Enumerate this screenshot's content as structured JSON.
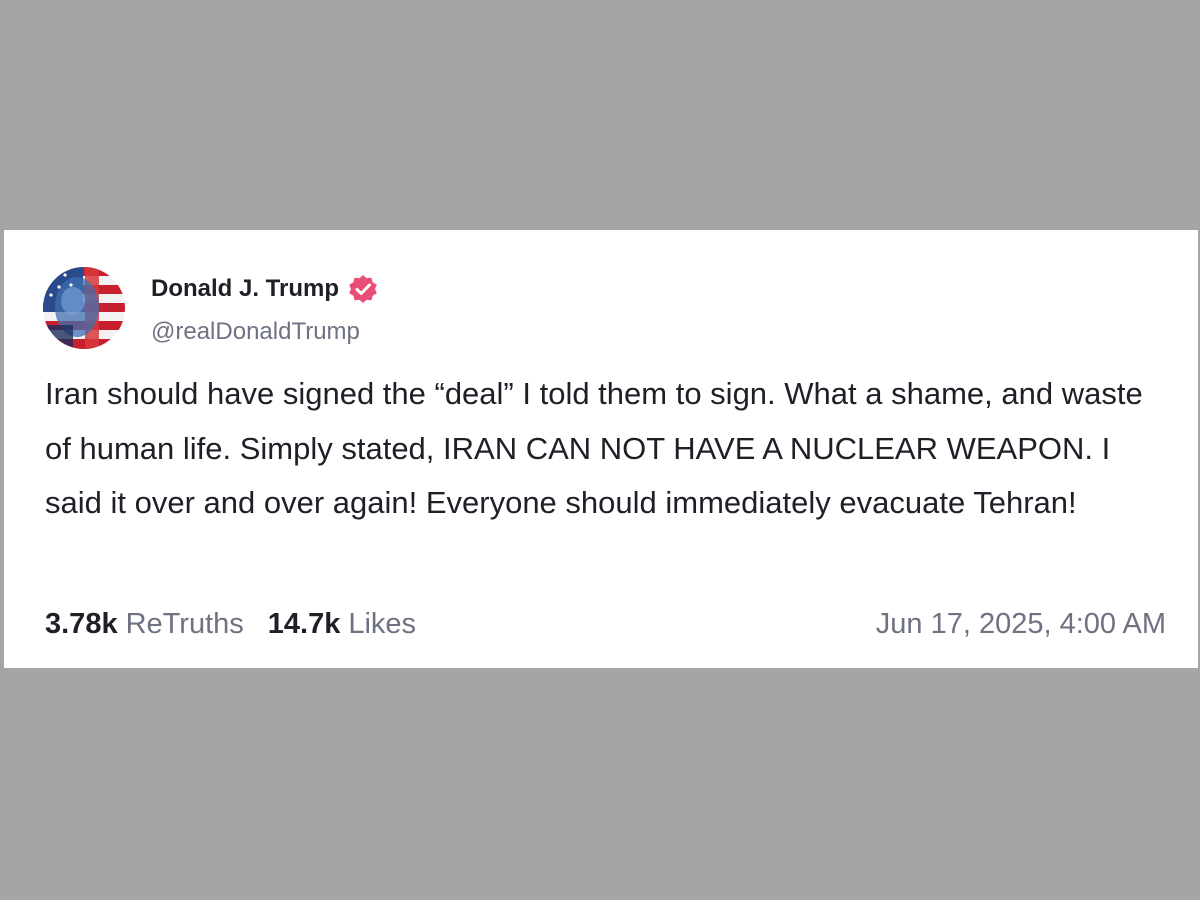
{
  "post": {
    "author": {
      "display_name": "Donald J. Trump",
      "handle": "@realDonaldTrump",
      "verified": true,
      "verified_badge_color": "#e94e77",
      "avatar_icon": "flag-portrait-avatar"
    },
    "text": "Iran should have signed the “deal” I told them to sign. What a shame, and waste of human life. Simply stated, IRAN CAN NOT HAVE A NUCLEAR WEAPON. I said it over and over again! Everyone should immediately evacuate Tehran!",
    "stats": {
      "retruths_count": "3.78k",
      "retruths_label": "ReTruths",
      "likes_count": "14.7k",
      "likes_label": "Likes"
    },
    "timestamp": "Jun 17, 2025, 4:00 AM"
  },
  "colors": {
    "background": "#a5a5a5",
    "card": "#ffffff",
    "text_primary": "#1f1f28",
    "text_secondary": "#6f7282"
  }
}
